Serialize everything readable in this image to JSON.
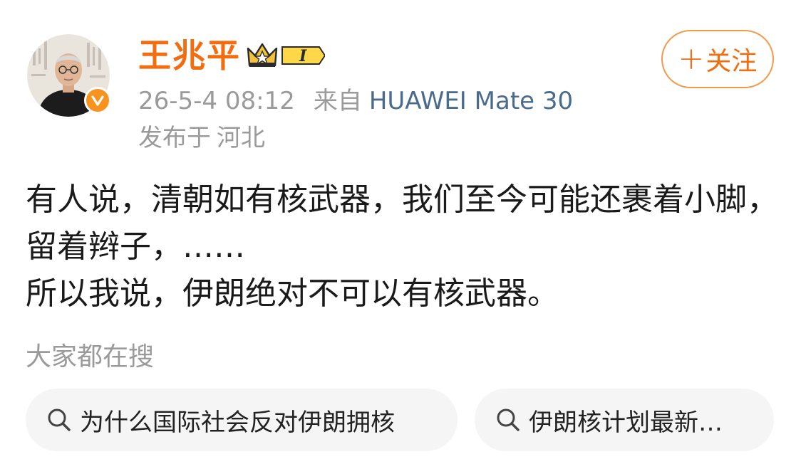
{
  "post": {
    "author": {
      "name": "王兆平",
      "vip_level": "I",
      "verified": true
    },
    "meta": {
      "time": "26-5-4 08:12",
      "from_label": "来自",
      "device": "HUAWEI Mate 30",
      "location_label": "发布于",
      "location": "河北"
    },
    "follow_label": "关注",
    "follow_plus": "+",
    "body": [
      "有人说，清朝如有核武器，我们至今可能还裹着小脚，留着辫子，……",
      "所以我说，伊朗绝对不可以有核武器。"
    ]
  },
  "related_search": {
    "title": "大家都在搜",
    "chips": [
      {
        "text": "为什么国际社会反对伊朗拥核"
      },
      {
        "text": "伊朗核计划最新…"
      }
    ]
  },
  "colors": {
    "accent": "#f26c10",
    "follow_border": "#f29a4a",
    "meta_gray": "#9a9a9a",
    "device_blue": "#4a6b8c",
    "verify_badge": "#f7931e",
    "chip_bg": "#f5f5f5",
    "text": "#1a1a1a"
  },
  "icons": {
    "verify": "verified-v-badge-icon",
    "vip": "crown-vip-icon",
    "search": "search-icon"
  }
}
